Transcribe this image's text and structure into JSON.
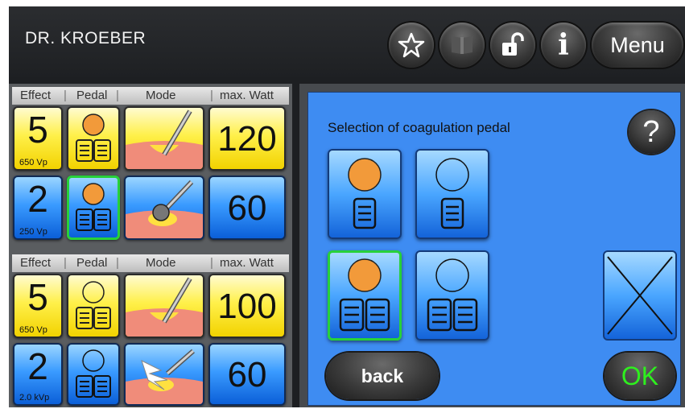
{
  "header": {
    "title": "DR. KROEBER",
    "buttons": [
      {
        "icon": "star-icon"
      },
      {
        "icon": "book-icon"
      },
      {
        "icon": "unlock-icon"
      },
      {
        "icon": "info-icon",
        "glyph": "i"
      }
    ],
    "menu_label": "Menu"
  },
  "left_panel": {
    "columns": [
      "Effect",
      "Pedal",
      "Mode",
      "max. Watt"
    ],
    "groups": [
      {
        "rows": [
          {
            "effect": "5",
            "effect_sub": "650 Vp",
            "color": "yellow",
            "pedal_circle": "filled",
            "pedal_type": "double",
            "mode": "blade",
            "watt": "120"
          },
          {
            "effect": "2",
            "effect_sub": "250 Vp",
            "color": "blue",
            "pedal_circle": "filled",
            "pedal_type": "double",
            "pedal_selected": true,
            "mode": "ball",
            "watt": "60"
          }
        ]
      },
      {
        "rows": [
          {
            "effect": "5",
            "effect_sub": "650 Vp",
            "color": "yellow",
            "pedal_circle": "empty",
            "pedal_type": "double",
            "mode": "blade",
            "watt": "100"
          },
          {
            "effect": "2",
            "effect_sub": "2.0 kVp",
            "color": "blue",
            "pedal_circle": "empty",
            "pedal_type": "double",
            "mode": "spark",
            "watt": "60"
          }
        ]
      }
    ]
  },
  "dialog": {
    "title": "Selection of coagulation pedal",
    "help_label": "?",
    "back_label": "back",
    "ok_label": "OK",
    "options": [
      {
        "circle": "filled",
        "pedal": "single",
        "selected": false
      },
      {
        "circle": "empty",
        "pedal": "single",
        "selected": false
      },
      {
        "circle": "filled",
        "pedal": "double",
        "selected": true
      },
      {
        "circle": "empty",
        "pedal": "double",
        "selected": false
      }
    ],
    "cancel_icon": "close-icon"
  },
  "colors": {
    "accent_blue": "#3e8cf2",
    "selection_green": "#27d13a",
    "ok_green": "#2ef01e",
    "effect_yellow": "#fff04a",
    "pedal_orange": "#f29a3a"
  }
}
